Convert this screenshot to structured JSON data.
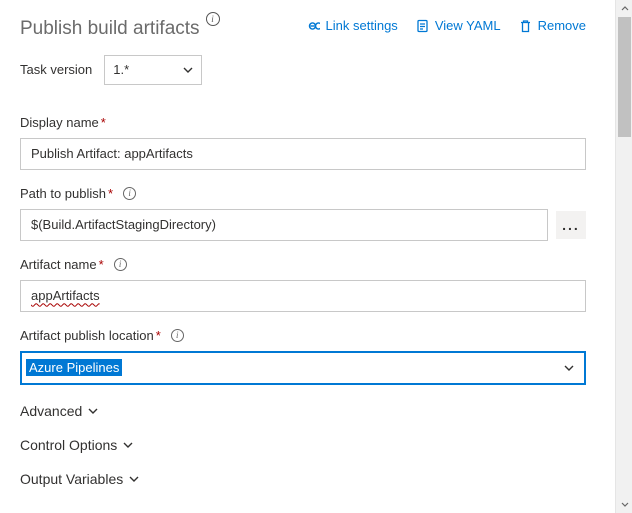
{
  "title": "Publish build artifacts",
  "actions": {
    "link_settings": "Link settings",
    "view_yaml": "View YAML",
    "remove": "Remove"
  },
  "task_version": {
    "label": "Task version",
    "value": "1.*"
  },
  "fields": {
    "display_name": {
      "label": "Display name",
      "value": "Publish Artifact: appArtifacts"
    },
    "path_to_publish": {
      "label": "Path to publish",
      "value": "$(Build.ArtifactStagingDirectory)"
    },
    "artifact_name": {
      "label": "Artifact name",
      "value": "appArtifacts"
    },
    "artifact_publish_location": {
      "label": "Artifact publish location",
      "value": "Azure Pipelines"
    }
  },
  "sections": {
    "advanced": "Advanced",
    "control_options": "Control Options",
    "output_variables": "Output Variables"
  },
  "asterisk": "*",
  "info_glyph": "i",
  "ellipsis": "..."
}
